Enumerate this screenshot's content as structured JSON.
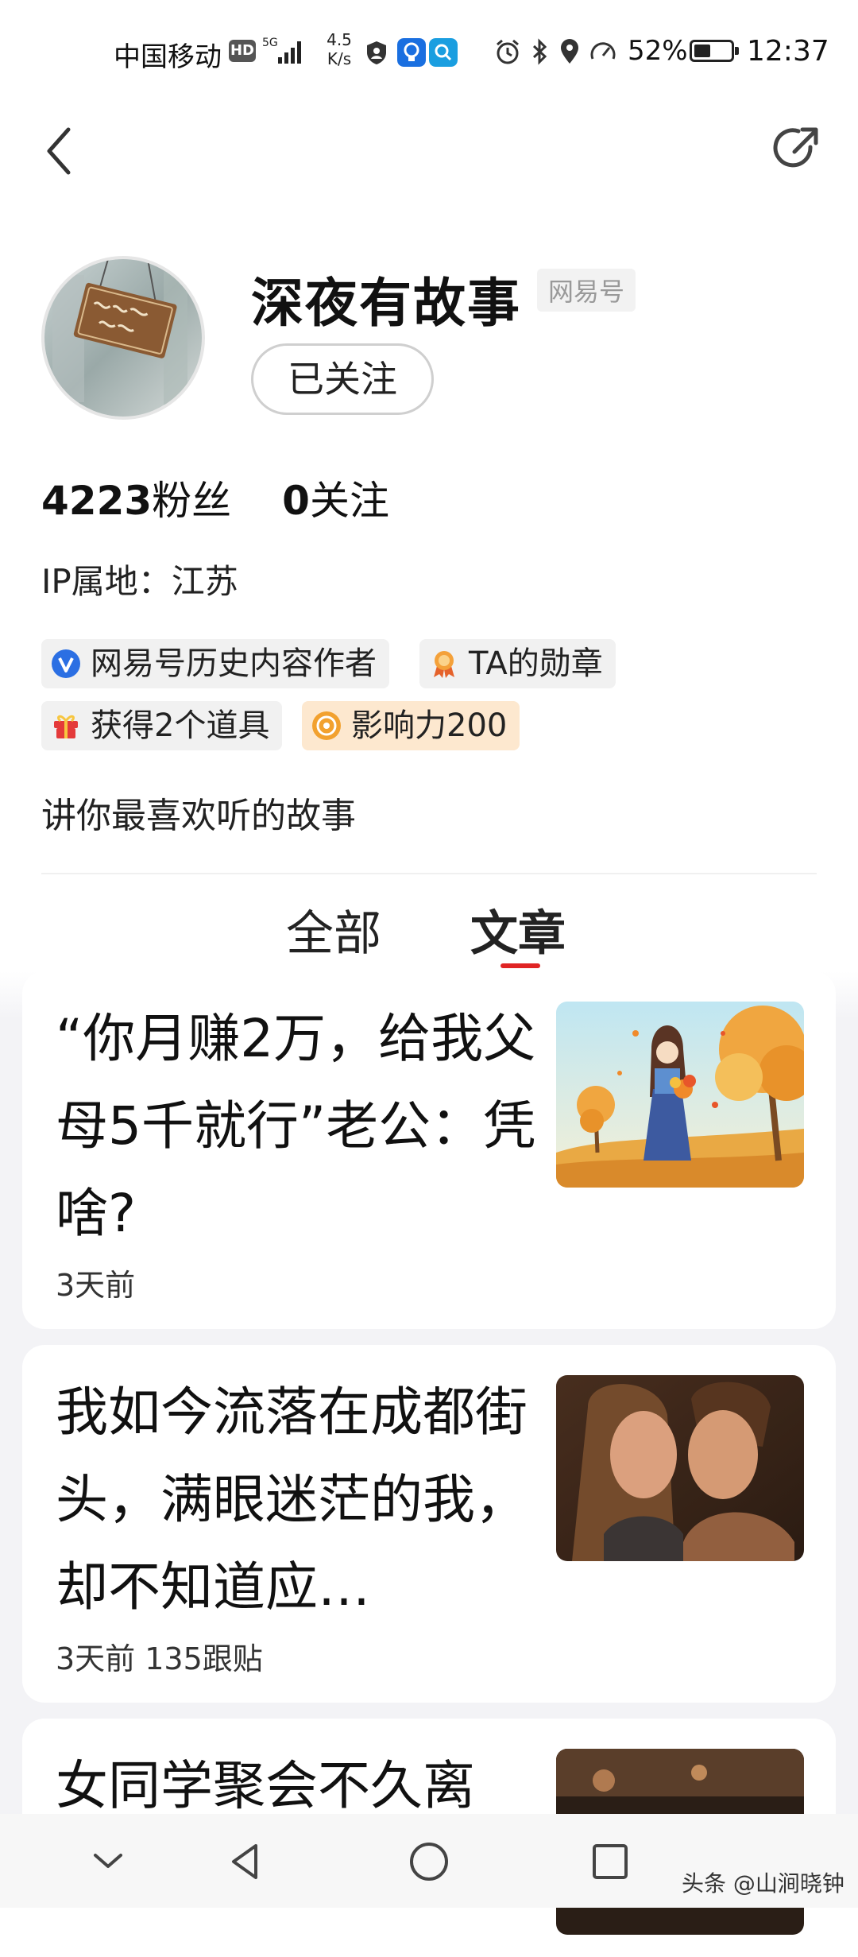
{
  "status_bar": {
    "carrier": "中国移动",
    "hd_label": "HD",
    "network": "5G",
    "net_speed_value": "4.5",
    "net_speed_unit": "K/s",
    "battery_text": "52%",
    "battery_level": 0.52,
    "time": "12:37"
  },
  "profile": {
    "name": "深夜有故事",
    "account_type": "网易号",
    "follow_label": "已关注",
    "followers_count": "4223",
    "followers_label": "粉丝",
    "following_count": "0",
    "following_label": "关注",
    "ip_location": "IP属地：江苏",
    "badges": [
      {
        "label": "网易号历史内容作者",
        "icon": "verified-v-icon"
      },
      {
        "label": "TA的勋章",
        "icon": "medal-icon"
      },
      {
        "label": "获得2个道具",
        "icon": "gift-icon"
      },
      {
        "label": "影响力200",
        "icon": "influence-icon"
      }
    ],
    "bio": "讲你最喜欢听的故事"
  },
  "tabs": [
    {
      "label": "全部",
      "active": false
    },
    {
      "label": "文章",
      "active": true
    }
  ],
  "articles": [
    {
      "title": "“你月赚2万，给我父母5千就行”老公：凭啥?",
      "meta": "3天前"
    },
    {
      "title": "我如今流落在成都街头，满眼迷茫的我，却不知道应…",
      "meta": "3天前  135跟贴"
    },
    {
      "title": "女同学聚会不久离",
      "meta": ""
    }
  ],
  "watermark": "头条 @山涧晓钟",
  "colors": {
    "accent_red": "#e02424",
    "badge_orange": "#fde8cf",
    "badge_gray": "#f1f1f1"
  }
}
